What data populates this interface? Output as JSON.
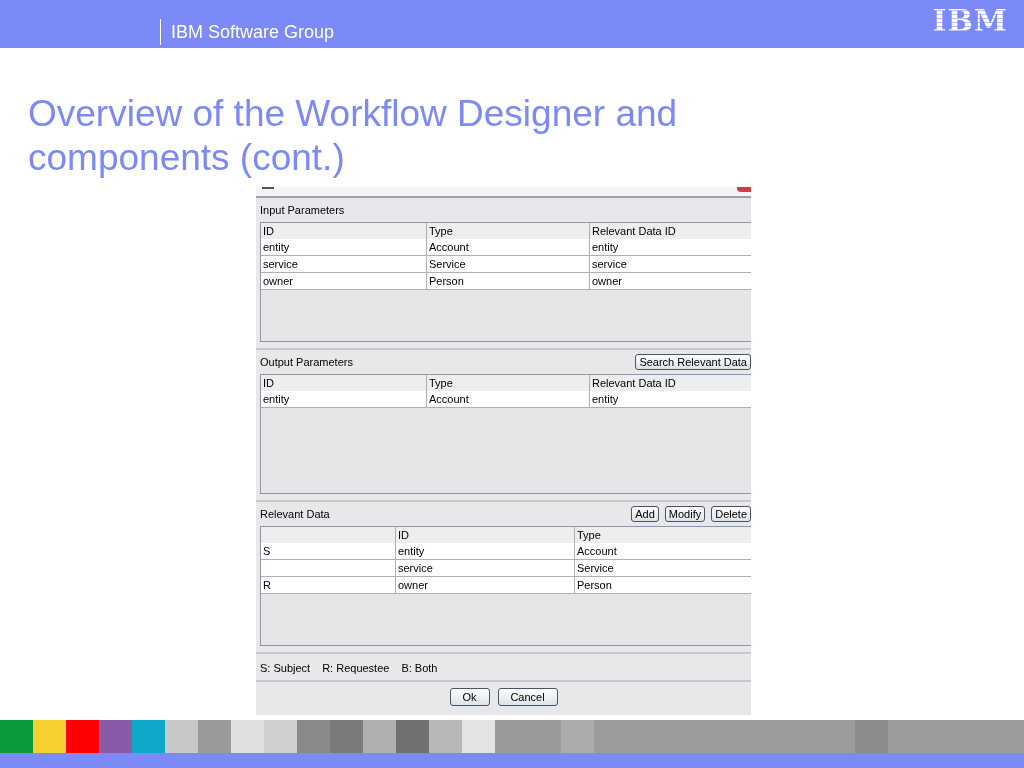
{
  "header": {
    "group": "IBM Software Group",
    "logo": "IBM"
  },
  "title": "Overview of the Workflow Designer and components (cont.)",
  "dialog": {
    "sections": [
      {
        "kind": "params",
        "label": "Input Parameters",
        "columns": [
          "ID",
          "Type",
          "Relevant Data ID"
        ],
        "rows": [
          [
            "entity",
            "Account",
            "entity"
          ],
          [
            "service",
            "Service",
            "service"
          ],
          [
            "owner",
            "Person",
            "owner"
          ]
        ]
      },
      {
        "kind": "params",
        "label": "Output Parameters",
        "buttons": [
          "Search Relevant Data"
        ],
        "columns": [
          "ID",
          "Type",
          "Relevant Data ID"
        ],
        "rows": [
          [
            "entity",
            "Account",
            "entity"
          ]
        ]
      },
      {
        "kind": "relevant",
        "label": "Relevant Data",
        "buttons": [
          "Add",
          "Modify",
          "Delete"
        ],
        "columns": [
          "ID",
          "Type"
        ],
        "rows": [
          {
            "role": "S",
            "id": "entity",
            "type": "Account"
          },
          {
            "id": "service",
            "type": "Service"
          },
          {
            "role": "R",
            "id": "owner",
            "type": "Person"
          }
        ]
      }
    ],
    "legend": [
      "S: Subject",
      "R: Requestee",
      "B: Both"
    ],
    "buttons": [
      "Ok",
      "Cancel"
    ]
  }
}
